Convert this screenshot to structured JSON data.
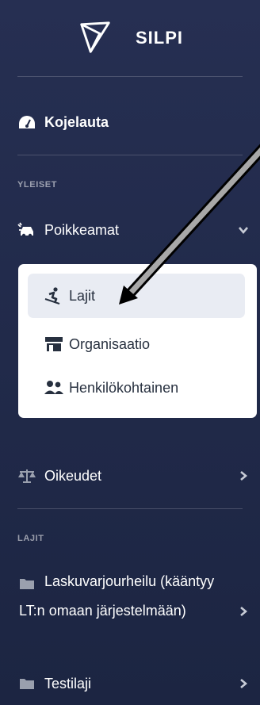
{
  "brand": {
    "title": "SILPI"
  },
  "nav": {
    "dashboard": "Kojelauta",
    "section_general": "YLEISET",
    "deviations": "Poikkeamat",
    "rights": "Oikeudet",
    "section_sports": "LAJIT"
  },
  "submenu": {
    "items": [
      {
        "label": "Lajit",
        "icon": "skier-icon"
      },
      {
        "label": "Organisaatio",
        "icon": "store-icon"
      },
      {
        "label": "Henkilökohtainen",
        "icon": "users-icon"
      }
    ]
  },
  "sports": [
    {
      "label_line1": "Laskuvarjourheilu (kääntyy",
      "label_line2": "LT:n omaan järjestelmään)"
    },
    {
      "label": "Testilaji"
    }
  ],
  "colors": {
    "sidebar_bg": "#1f2845",
    "text": "#ffffff",
    "submenu_bg": "#ffffff",
    "active_bg": "#e9ecf3",
    "submenu_text": "#27303f"
  }
}
